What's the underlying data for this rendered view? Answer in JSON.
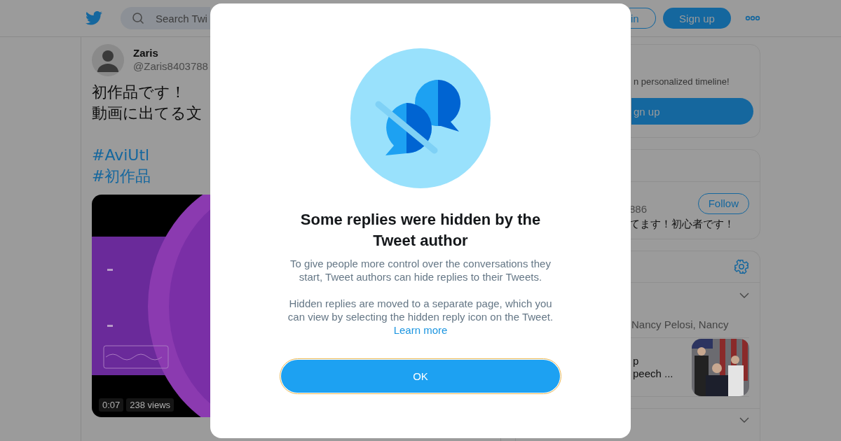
{
  "header": {
    "search": {
      "placeholder": "Search Twi"
    },
    "buttons": [
      {
        "label": "in",
        "kind": "outline"
      },
      {
        "label": "Sign up",
        "kind": "filled"
      }
    ]
  },
  "tweet": {
    "name": "Zaris",
    "handle": "@Zaris8403788",
    "lines": [
      "初作品です！",
      "動画に出てる文"
    ],
    "hashtags": [
      "#AviUtl",
      "#初作品"
    ],
    "video": {
      "duration": "0:07",
      "views": "238 views"
    }
  },
  "sidebar": {
    "signup_card": {
      "text": "n personalized timeline!",
      "button": "gn up"
    },
    "follow_card": {
      "handle": "886",
      "button": "Follow",
      "bio": "てます！初心者です！"
    },
    "trends_card": {
      "trends": [
        {
          "kind": "text",
          "text": "Nancy Pelosi, Nancy"
        },
        {
          "kind": "story",
          "lines": [
            "p",
            "peech ..."
          ]
        }
      ]
    }
  },
  "modal": {
    "title": "Some replies were hidden by the Tweet author",
    "paragraphs": [
      "To give people more control over the conversations they start, Tweet authors can hide replies to their Tweets.",
      "Hidden replies are moved to a separate page, which you can view by selecting the hidden reply icon on the Tweet."
    ],
    "link": "Learn more",
    "button": {
      "label": "OK",
      "focused": true
    }
  }
}
